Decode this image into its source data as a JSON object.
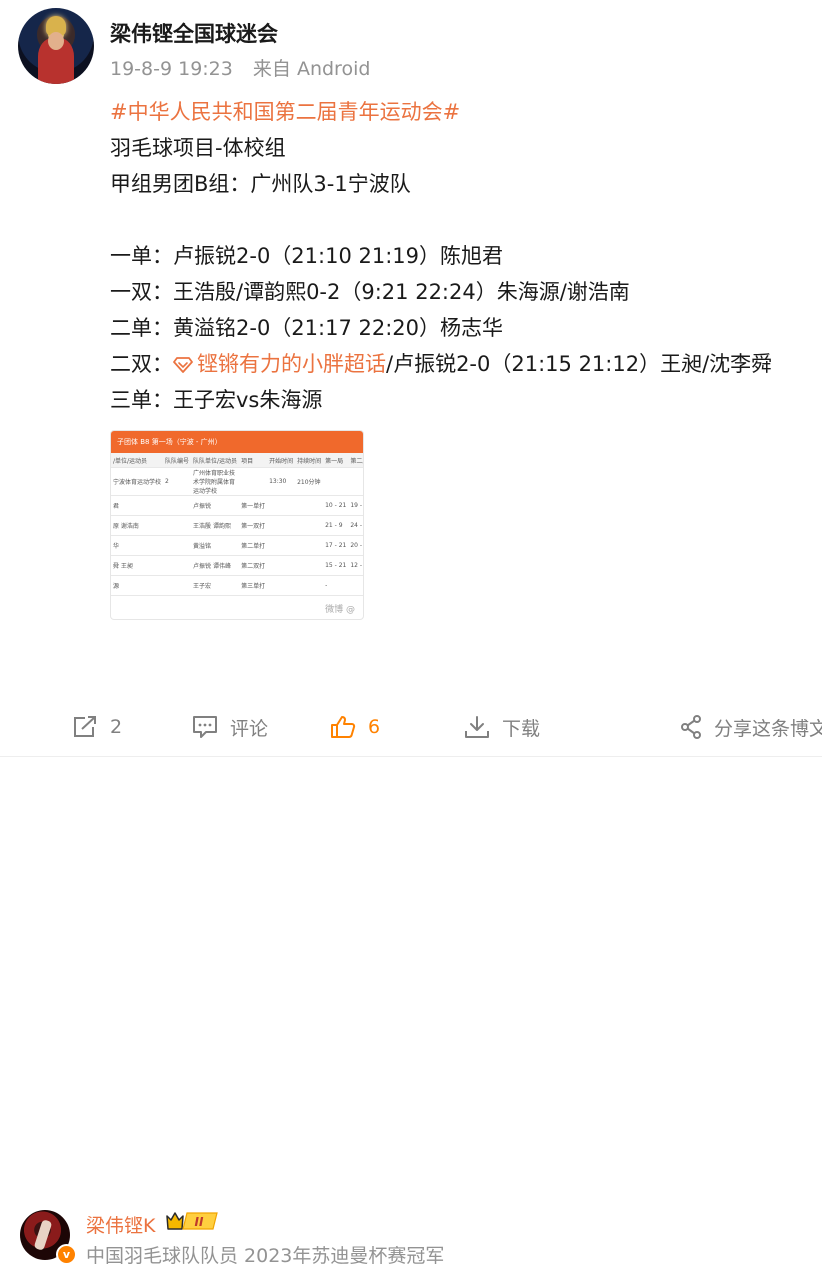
{
  "post": {
    "author": "梁伟铿全国球迷会",
    "time": "19-8-9 19:23",
    "source": "来自 Android",
    "hashtag": "#中华人民共和国第二届青年运动会#",
    "line_event": "羽毛球项目-体校组",
    "line_group": "甲组男团B组：广州队3-1宁波队",
    "line_ms1": "一单：卢振锐2-0（21:10 21:19）陈旭君",
    "line_md1": "一双：王浩殷/谭韵熙0-2（9:21 22:24）朱海源/谢浩南",
    "line_ms2": "二单：黄溢铭2-0（21:17 22:20）杨志华",
    "line_md2_prefix": "二双：",
    "supertopic": "铿锵有力的小胖超话",
    "line_md2_rest": "/卢振锐2-0（21:15 21:12）王昶/沈李舜",
    "line_ms3": "三单：王子宏vs朱海源"
  },
  "thumbnail": {
    "bar_text": "子团体  B8 第一场（宁波 - 广州）",
    "headers": [
      "/单位/运动员",
      "队队编号",
      "队队单位/运动员",
      "项目",
      "开始时间",
      "持续时间",
      "第一局",
      "第二局"
    ],
    "rows": [
      [
        "宁波体育运动学校",
        "2",
        "广州体育职业技术学院附属体育运动学校",
        "",
        "13:30",
        "210分钟",
        "",
        ""
      ],
      [
        "君",
        "",
        "卢振锐",
        "第一单打",
        "",
        "",
        "10 - 21",
        "19 - 21"
      ],
      [
        "原 谢浩南",
        "",
        "王浩殷 谭韵熙",
        "第一双打",
        "",
        "",
        "21 - 9",
        "24 - 22"
      ],
      [
        "华",
        "",
        "黄溢铭",
        "第二单打",
        "",
        "",
        "17 - 21",
        "20 - 22"
      ],
      [
        "舜 王昶",
        "",
        "卢振锐 谭伟峰",
        "第二双打",
        "",
        "",
        "15 - 21",
        "12 - 21"
      ],
      [
        "源",
        "",
        "王子宏",
        "第三单打",
        "",
        "",
        "-",
        ""
      ]
    ],
    "watermark": "微博 @"
  },
  "actions": {
    "repost_count": "2",
    "comment_label": "评论",
    "like_count": "6",
    "download_label": "下载",
    "share_label": "分享这条博文"
  },
  "author_card": {
    "name": "梁伟铿K",
    "level": "II",
    "description": "中国羽毛球队队员 2023年苏迪曼杯赛冠军"
  },
  "colors": {
    "accent": "#eb7340",
    "like": "#ff8200",
    "meta_gray": "#939393"
  }
}
